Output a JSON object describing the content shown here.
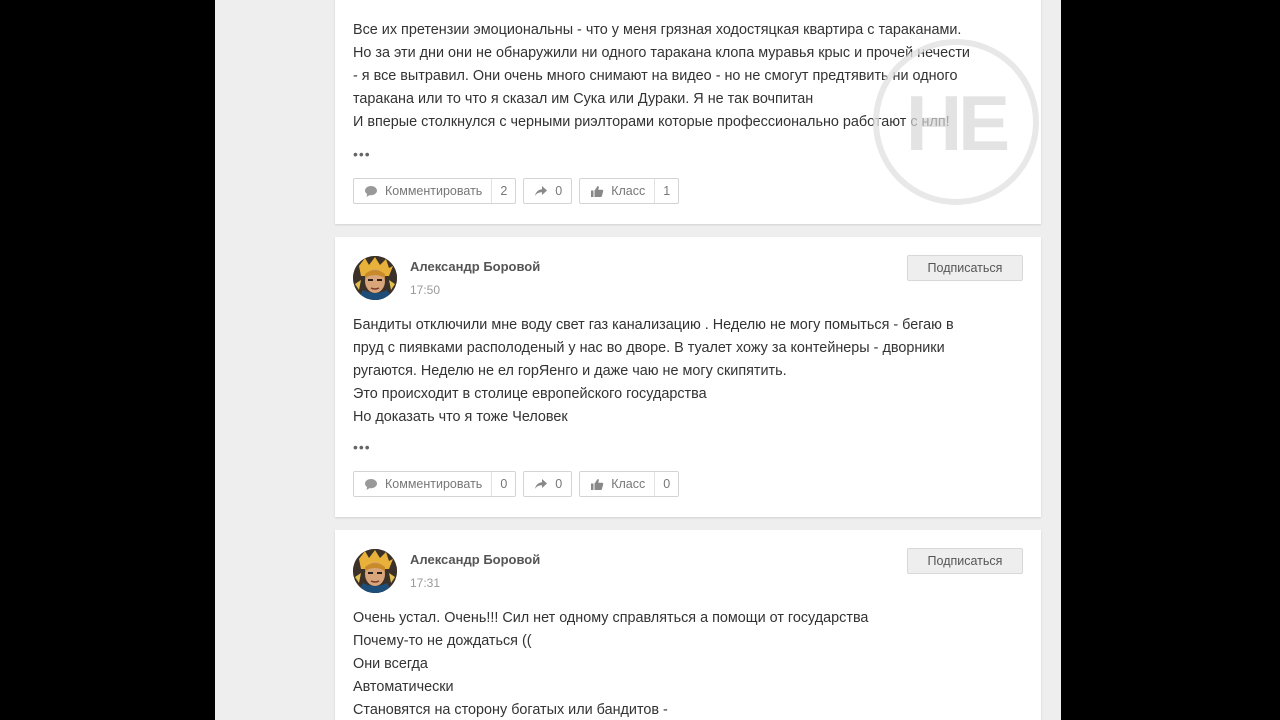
{
  "posts": [
    {
      "lines": [
        "Все их претензии эмоциональны -  что у меня грязная ходостяцкая квартира с тараканами.",
        "Но за эти дни они не обнаружили ни одного таракана клопа муравья крыс и прочей нечести",
        " -  я все вытравил. Они очень много снимают на видео  -  но не смогут предтявить ни одного",
        "таракана или то что я сказал им Сука или Дураки. Я не так вочпитан",
        "И вперые столкнулся с черными риэлторами которые профессионально работают с нлп!"
      ],
      "more": "•••",
      "actions": {
        "comment_label": "Комментировать",
        "comment_count": "2",
        "share_count": "0",
        "like_label": "Класс",
        "like_count": "1"
      }
    },
    {
      "author": "Александр Боровой",
      "time": "17:50",
      "subscribe_label": "Подписаться",
      "lines": [
        "Бандиты отключили мне воду свет газ канализацию . Неделю не могу помыться  -  бегаю в",
        "пруд с пиявками располоденый у нас во дворе. В туалет хожу за контейнеры  -  дворники",
        "ругаются. Неделю не ел горЯенго и даже чаю не могу скипятить.",
        "Это происходит в столице европейского государства",
        "Но доказать что я тоже  Человек"
      ],
      "more": "•••",
      "actions": {
        "comment_label": "Комментировать",
        "comment_count": "0",
        "share_count": "0",
        "like_label": "Класс",
        "like_count": "0"
      }
    },
    {
      "author": "Александр Боровой",
      "time": "17:31",
      "subscribe_label": "Подписаться",
      "lines": [
        "Очень устал.  Очень!!! Сил нет одному справляться а помощи от государства",
        "Почему-то не дождаться  ((",
        "Они всегда",
        "Автоматически",
        "Становятся на сторону богатых или бандитов  -"
      ]
    }
  ],
  "watermark": {
    "text": "НЕ"
  },
  "colors": {
    "page_bg": "#eeeeee",
    "card_bg": "#ffffff",
    "text": "#333333",
    "muted": "#999999",
    "frame": "#000000"
  }
}
